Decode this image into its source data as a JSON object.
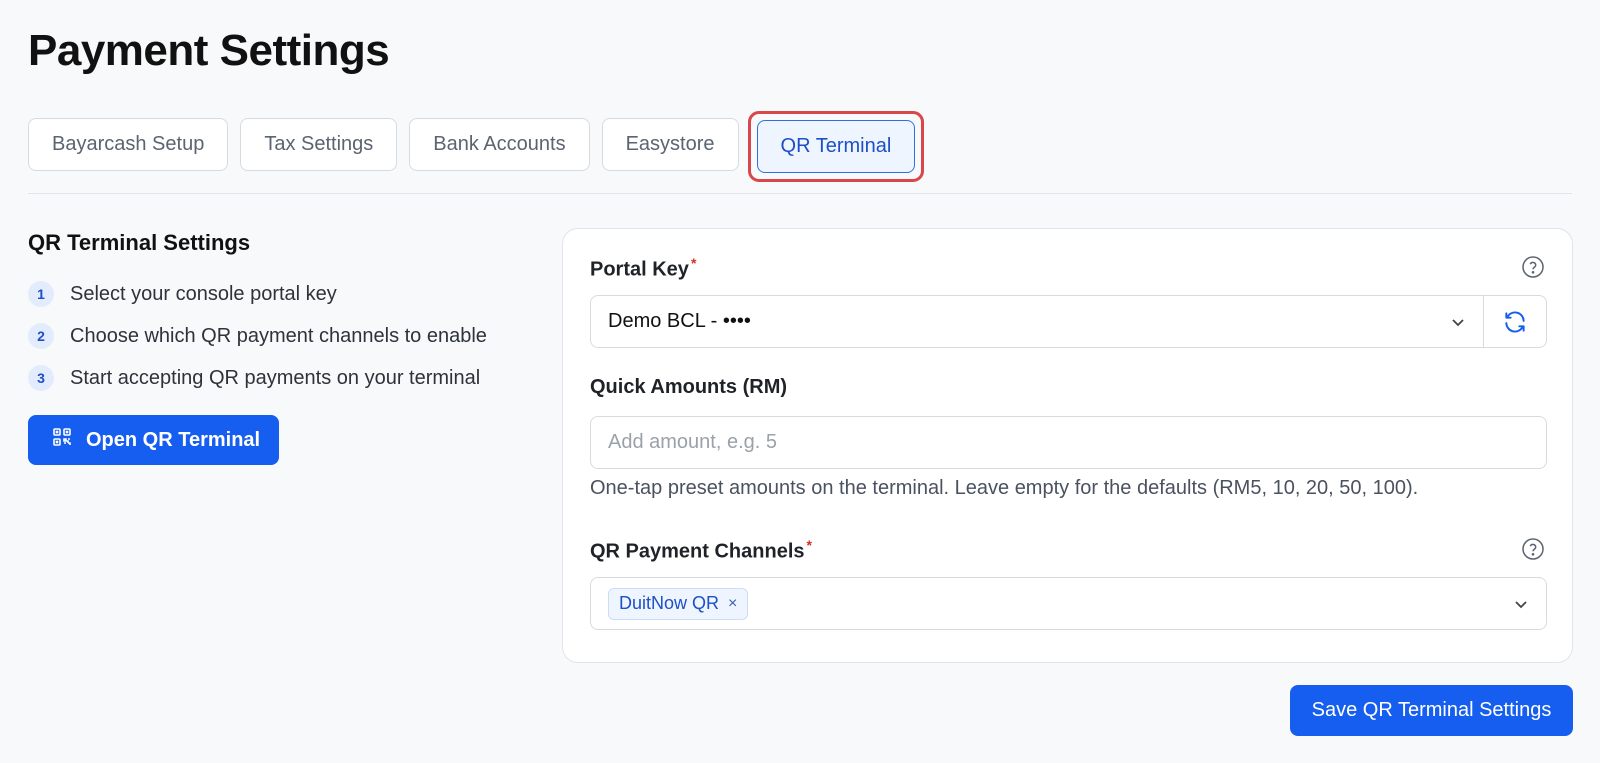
{
  "page": {
    "title": "Payment Settings"
  },
  "tabs": [
    {
      "label": "Bayarcash Setup"
    },
    {
      "label": "Tax Settings"
    },
    {
      "label": "Bank Accounts"
    },
    {
      "label": "Easystore"
    },
    {
      "label": "QR Terminal",
      "active": true
    }
  ],
  "left_panel": {
    "heading": "QR Terminal Settings",
    "steps": [
      {
        "num": "1",
        "text": "Select your console portal key"
      },
      {
        "num": "2",
        "text": "Choose which QR payment channels to enable"
      },
      {
        "num": "3",
        "text": "Start accepting QR payments on your terminal"
      }
    ],
    "open_button": {
      "label": "Open QR Terminal",
      "icon": "qr-code-icon"
    }
  },
  "form": {
    "portal_key": {
      "label": "Portal Key",
      "required_mark": "*",
      "value": "Demo BCL - ••••"
    },
    "quick_amounts": {
      "label": "Quick Amounts (RM)",
      "placeholder": "Add amount, e.g. 5",
      "value": "",
      "hint": "One-tap preset amounts on the terminal. Leave empty for the defaults (RM5, 10, 20, 50, 100)."
    },
    "channels": {
      "label": "QR Payment Channels",
      "required_mark": "*",
      "chips": [
        {
          "label": "DuitNow QR",
          "remove": "×"
        }
      ]
    },
    "save_button": "Save QR Terminal Settings"
  },
  "colors": {
    "primary": "#155eef",
    "active_tab_bg": "#eef5ff",
    "highlight_outline": "#d9464b",
    "required": "#d92d20"
  }
}
